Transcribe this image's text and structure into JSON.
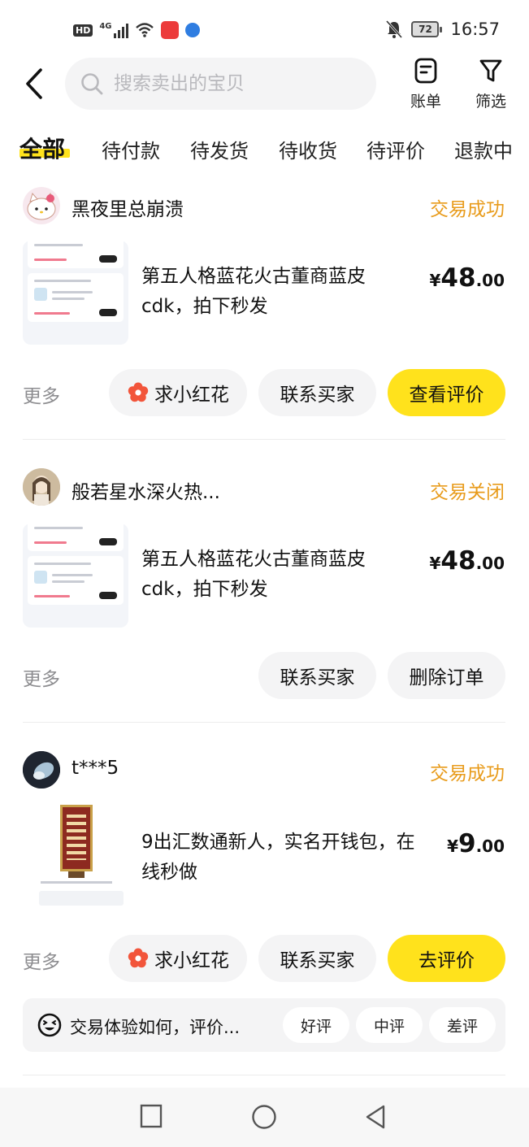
{
  "status_bar": {
    "hd": "HD",
    "network": "4G",
    "battery": "72",
    "time": "16:57"
  },
  "header": {
    "search_placeholder": "搜索卖出的宝贝",
    "bill_label": "账单",
    "filter_label": "筛选"
  },
  "tabs": [
    {
      "label": "全部",
      "active": true
    },
    {
      "label": "待付款"
    },
    {
      "label": "待发货"
    },
    {
      "label": "待收货"
    },
    {
      "label": "待评价"
    },
    {
      "label": "退款中"
    }
  ],
  "orders": [
    {
      "buyer": "黑夜里总崩溃",
      "status": "交易成功",
      "title": "第五人格蓝花火古董商蓝皮cdk，拍下秒发",
      "price_currency": "¥",
      "price_int": "48",
      "price_dec": ".00",
      "more": "更多",
      "actions": [
        "求小红花",
        "联系买家",
        "查看评价"
      ]
    },
    {
      "buyer": "般若星水深火热...",
      "status": "交易关闭",
      "title": "第五人格蓝花火古董商蓝皮cdk，拍下秒发",
      "price_currency": "¥",
      "price_int": "48",
      "price_dec": ".00",
      "more": "更多",
      "actions": [
        "联系买家",
        "删除订单"
      ]
    },
    {
      "buyer": "t***5",
      "status": "交易成功",
      "title": "9出汇数通新人，实名开钱包，在线秒做",
      "price_currency": "¥",
      "price_int": "9",
      "price_dec": ".00",
      "more": "更多",
      "actions": [
        "求小红花",
        "联系买家",
        "去评价"
      ]
    }
  ],
  "feedback": {
    "text": "交易体验如何，评价...",
    "options": [
      "好评",
      "中评",
      "差评"
    ]
  },
  "colors": {
    "accent_yellow": "#ffe21c",
    "status_orange": "#e89b1b",
    "flower_red": "#f2553b"
  }
}
